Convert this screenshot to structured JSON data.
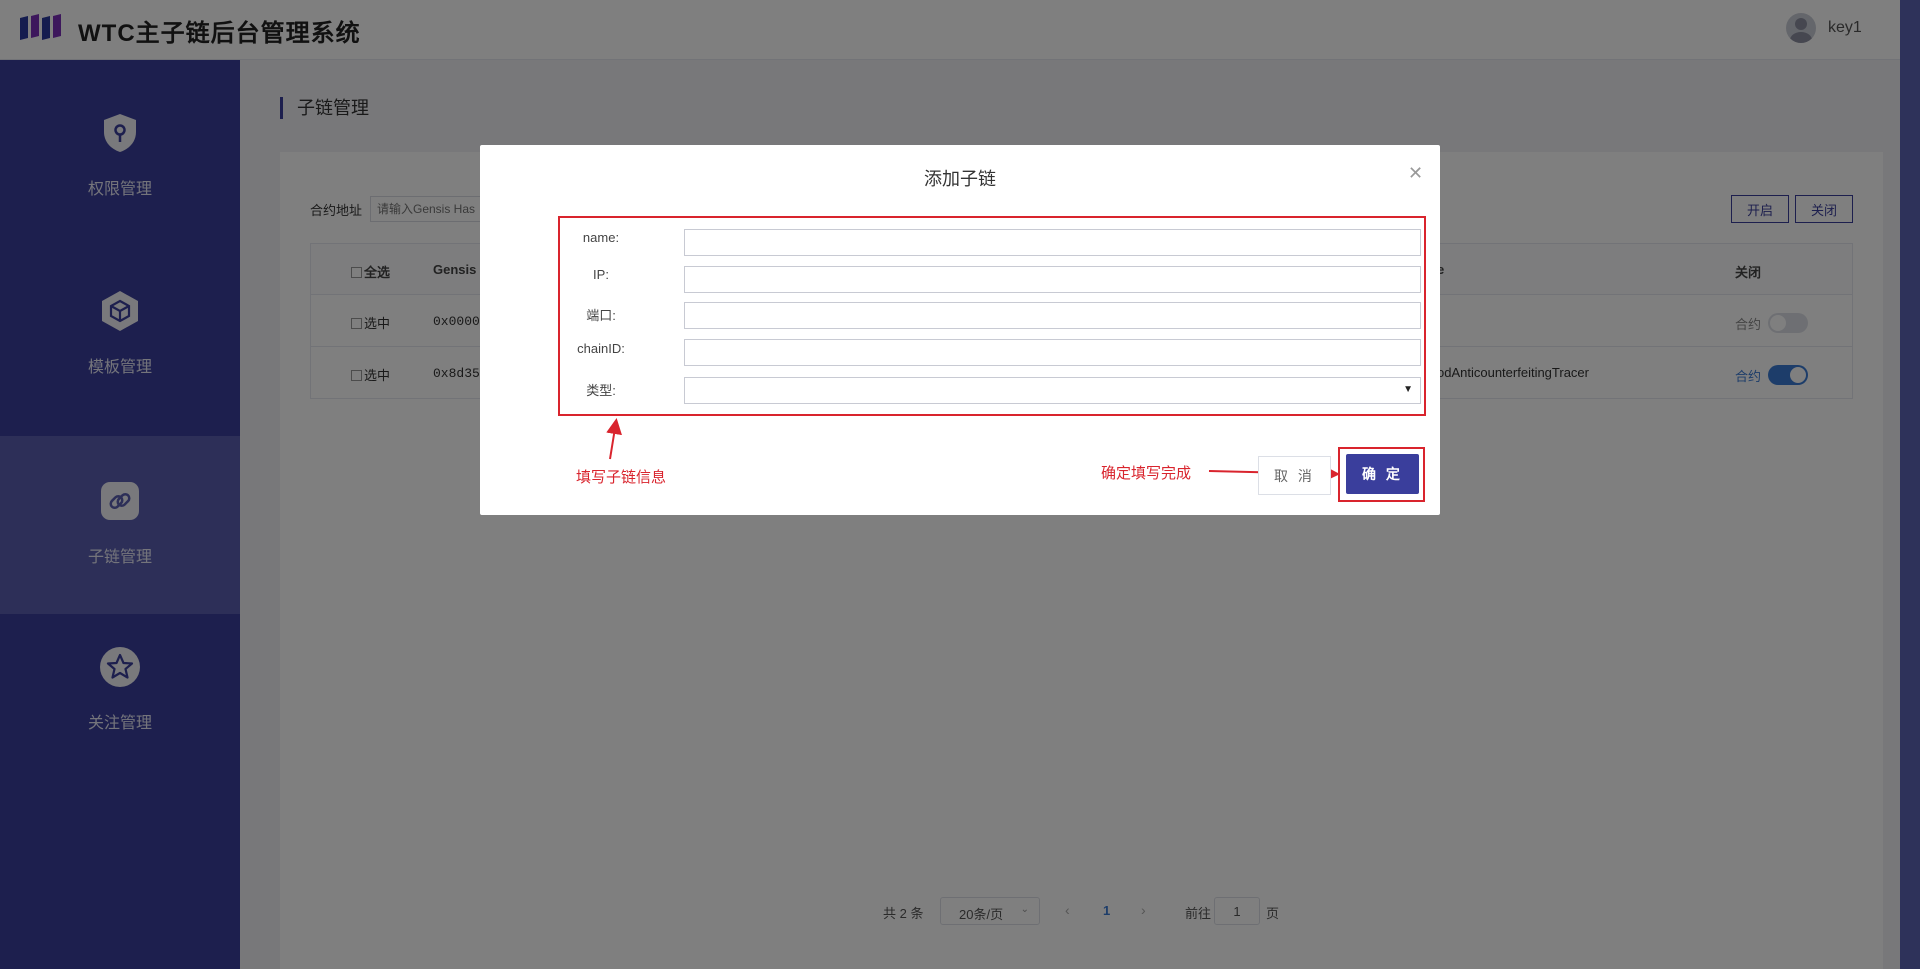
{
  "header": {
    "app_title": "WTC主子链后台管理系统",
    "username": "key1"
  },
  "sidebar": {
    "items": [
      {
        "label": "权限管理",
        "icon": "shield-key-icon",
        "active": false
      },
      {
        "label": "模板管理",
        "icon": "cube-icon",
        "active": false
      },
      {
        "label": "子链管理",
        "icon": "link-icon",
        "active": true
      },
      {
        "label": "关注管理",
        "icon": "star-icon",
        "active": false
      }
    ]
  },
  "main": {
    "page_title": "子链管理",
    "filter": {
      "label": "合约地址",
      "placeholder": "请输入Gensis Has"
    },
    "buttons": {
      "enable": "开启",
      "disable": "关闭"
    },
    "table": {
      "headers": {
        "select_all": "全选",
        "genesis": "Gensis",
        "name_partial": "e",
        "close": "关闭"
      },
      "rows": [
        {
          "select": "选中",
          "genesis": "0x00000",
          "name": "",
          "toggle_label": "合约",
          "enabled": false
        },
        {
          "select": "选中",
          "genesis": "0x8d357",
          "name": "odAnticounterfeitingTracer",
          "toggle_label": "合约",
          "enabled": true
        }
      ]
    },
    "pagination": {
      "total": "共 2 条",
      "page_size": "20条/页",
      "current_page": "1",
      "goto_prefix": "前往",
      "goto_value": "1",
      "goto_suffix": "页"
    }
  },
  "modal": {
    "title": "添加子链",
    "fields": {
      "name_label": "name:",
      "ip_label": "IP:",
      "port_label": "端口:",
      "chain_id_label": "chainID:",
      "type_label": "类型:"
    },
    "annotations": {
      "fill_info": "填写子链信息",
      "confirm_done": "确定填写完成"
    },
    "buttons": {
      "cancel": "取 消",
      "confirm": "确 定"
    }
  },
  "colors": {
    "sidebar": "#3a3e9c",
    "sidebar_active": "#5a5fb0",
    "annotation_red": "#d9242d",
    "toggle_on": "#3a7bd5"
  }
}
